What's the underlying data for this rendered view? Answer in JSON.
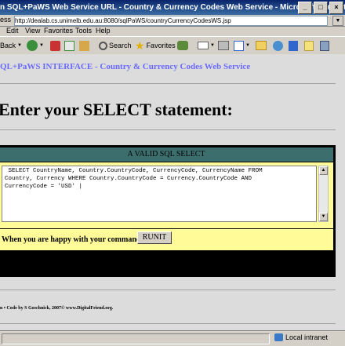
{
  "window": {
    "title": "n SQL+PaWS Web Service URL - Country & Currency Codes Web Service - Microsoft Internet Explorer",
    "minimize": "_",
    "maximize": "□",
    "close": "×"
  },
  "address": {
    "label": "ess",
    "url": "http://dealab.cs.unimelb.edu.au:8080/sqlPaWS/countryCurrencyCodesWS.jsp"
  },
  "menu": [
    "Edit",
    "View",
    "Favorites",
    "Tools",
    "Help"
  ],
  "toolbar": {
    "back": "Back",
    "search": "Search",
    "favorites": "Favorites"
  },
  "page": {
    "heading": "QL+PaWS INTERFACE - Country & Currency Codes Web Service",
    "enter_title": "Enter your SELECT statement:",
    "panel_header": "A VALID SQL SELECT",
    "sql_text": " SELECT CountryName, Country.CountryCode, CurrencyCode, CurrencyName FROM\nCountry, Currency WHERE Country.CountryCode = Currency.CountryCode AND\nCurrencyCode = 'USD' |",
    "foot_label": "When you are happy with your command:",
    "run_button": "RUNIT",
    "credits": "n • Code by S Goschnick, 2007© www.DigitalFriend.org."
  },
  "status": {
    "zone": "Local intranet"
  },
  "colors": {
    "panel_header": "#3c6e6e",
    "panel_body": "#fffb99",
    "heading": "#6a6aff"
  }
}
